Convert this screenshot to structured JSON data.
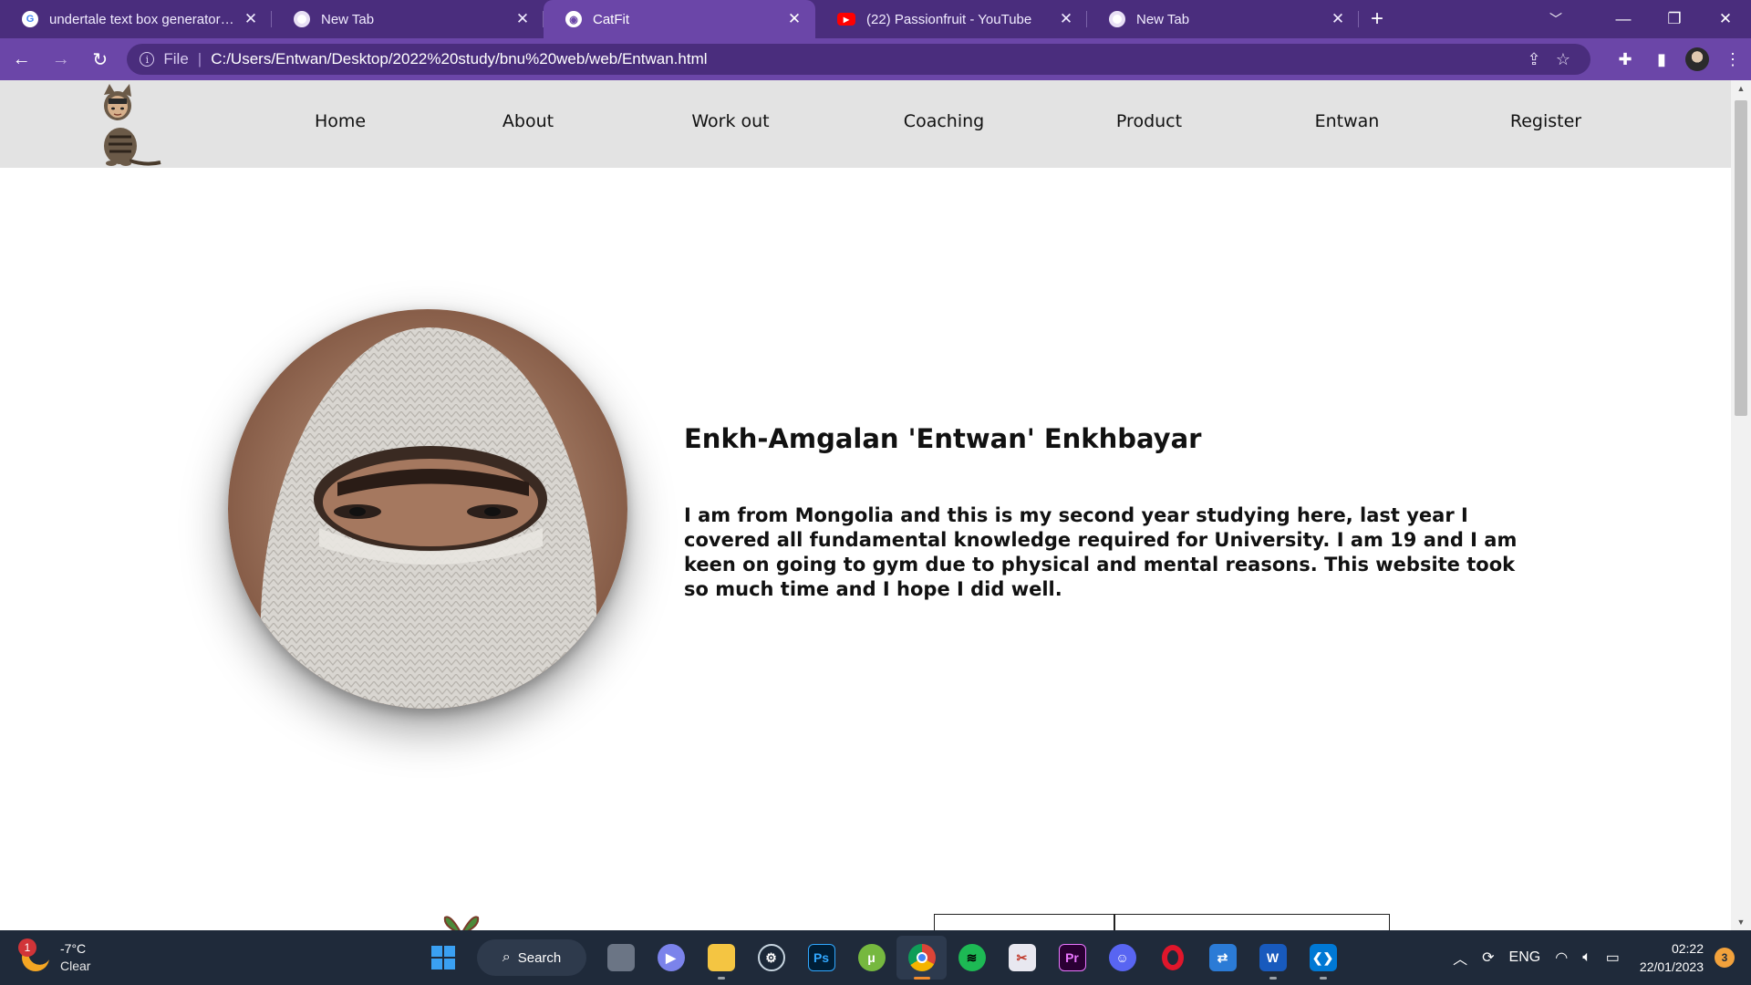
{
  "browser": {
    "tabs": [
      {
        "title": "undertale text box generator - Go",
        "favicon": "google-icon",
        "active": false
      },
      {
        "title": "New Tab",
        "favicon": "chrome-icon",
        "active": false
      },
      {
        "title": "CatFit",
        "favicon": "globe-icon",
        "active": true
      },
      {
        "title": "(22) Passionfruit - YouTube",
        "favicon": "youtube-icon",
        "active": false
      },
      {
        "title": "New Tab",
        "favicon": "chrome-icon",
        "active": false
      }
    ],
    "address": {
      "scheme": "File",
      "url": "C:/Users/Entwan/Desktop/2022%20study/bnu%20web/web/Entwan.html"
    },
    "colors": {
      "frame": "#4a2d7d",
      "toolbar": "#6b46a8"
    }
  },
  "site": {
    "nav": [
      "Home",
      "About",
      "Work out",
      "Coaching",
      "Product",
      "Entwan",
      "Register"
    ],
    "nav_bg": "#e3e3e3"
  },
  "profile": {
    "name": "Enkh-Amgalan 'Entwan' Enkhbayar",
    "bio": "I am from Mongolia and this is my second year studying here, last year I covered all fundamental knowledge required for University. I am 19 and I am keen on going to gym due to physical and mental reasons. This website took so much time and I hope I did well."
  },
  "taskbar": {
    "weather": {
      "badge": "1",
      "temp": "-7°C",
      "condition": "Clear"
    },
    "search_label": "Search",
    "apps": [
      {
        "name": "task-view-icon",
        "active": false
      },
      {
        "name": "teams-chat-icon",
        "active": false
      },
      {
        "name": "file-explorer-icon",
        "active": false
      },
      {
        "name": "steam-icon",
        "active": false
      },
      {
        "name": "photoshop-icon",
        "label": "Ps",
        "active": false
      },
      {
        "name": "utorrent-icon",
        "active": false
      },
      {
        "name": "chrome-icon",
        "active": true
      },
      {
        "name": "spotify-icon",
        "active": false
      },
      {
        "name": "snipping-tool-icon",
        "active": false
      },
      {
        "name": "premiere-icon",
        "label": "Pr",
        "active": false
      },
      {
        "name": "discord-icon",
        "active": false
      },
      {
        "name": "opera-icon",
        "active": false
      },
      {
        "name": "network-app-icon",
        "active": false
      },
      {
        "name": "word-icon",
        "label": "W",
        "active": false
      },
      {
        "name": "vscode-icon",
        "active": false
      }
    ],
    "tray": {
      "language": "ENG",
      "time": "02:22",
      "date": "22/01/2023",
      "notifications": "3"
    }
  }
}
